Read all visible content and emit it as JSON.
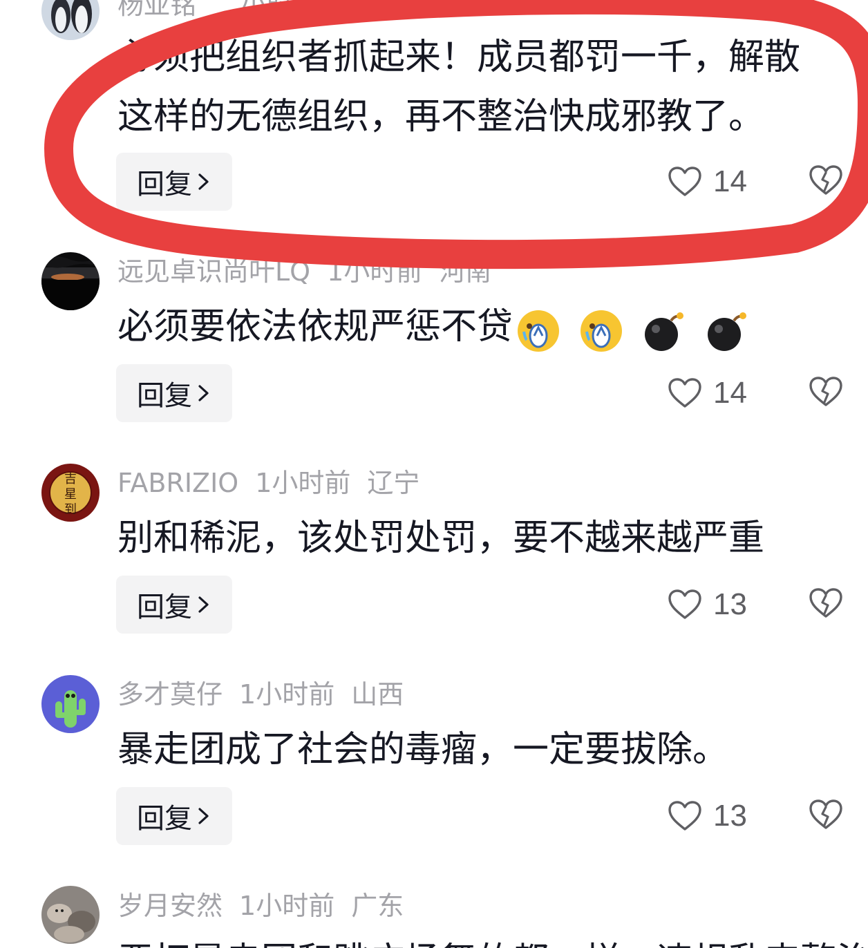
{
  "comments": [
    {
      "user": "杨亚铭",
      "time": "小时前",
      "location": "",
      "lines": [
        "必须把组织者抓起来！成员都罚一千，解散",
        "这样的无德组织，再不整治快成邪教了。"
      ],
      "reply_label": "回复",
      "likes": "14"
    },
    {
      "user": "远见卓识尚叶LQ",
      "time": "1小时前",
      "location": "河南",
      "lines": [
        "必须要依法依规严惩不贷"
      ],
      "emojis": [
        "cry-face-emoji",
        "cry-face-emoji",
        "bomb-emoji",
        "bomb-emoji"
      ],
      "reply_label": "回复",
      "likes": "14"
    },
    {
      "user": "FABRIZIO",
      "time": "1小时前",
      "location": "辽宁",
      "lines": [
        "别和稀泥，该处罚处罚，要不越来越严重"
      ],
      "reply_label": "回复",
      "likes": "13"
    },
    {
      "user": "多才莫仔",
      "time": "1小时前",
      "location": "山西",
      "lines": [
        "暴走团成了社会的毒瘤，一定要拔除。"
      ],
      "reply_label": "回复",
      "likes": "13"
    },
    {
      "user": "岁月安然",
      "time": "1小时前",
      "location": "广东",
      "lines": [
        "严打暴走团和跳广场舞的都一样，违规乱来整治属实"
      ]
    }
  ],
  "avatar_texts": {
    "fabrizio": [
      "吉",
      "星",
      "到"
    ]
  },
  "colors": {
    "annotation_red": "#e8403f",
    "meta_gray": "#a3a3a8",
    "text": "#161823",
    "reply_bg": "#f3f3f4",
    "count_gray": "#5f5f63"
  }
}
